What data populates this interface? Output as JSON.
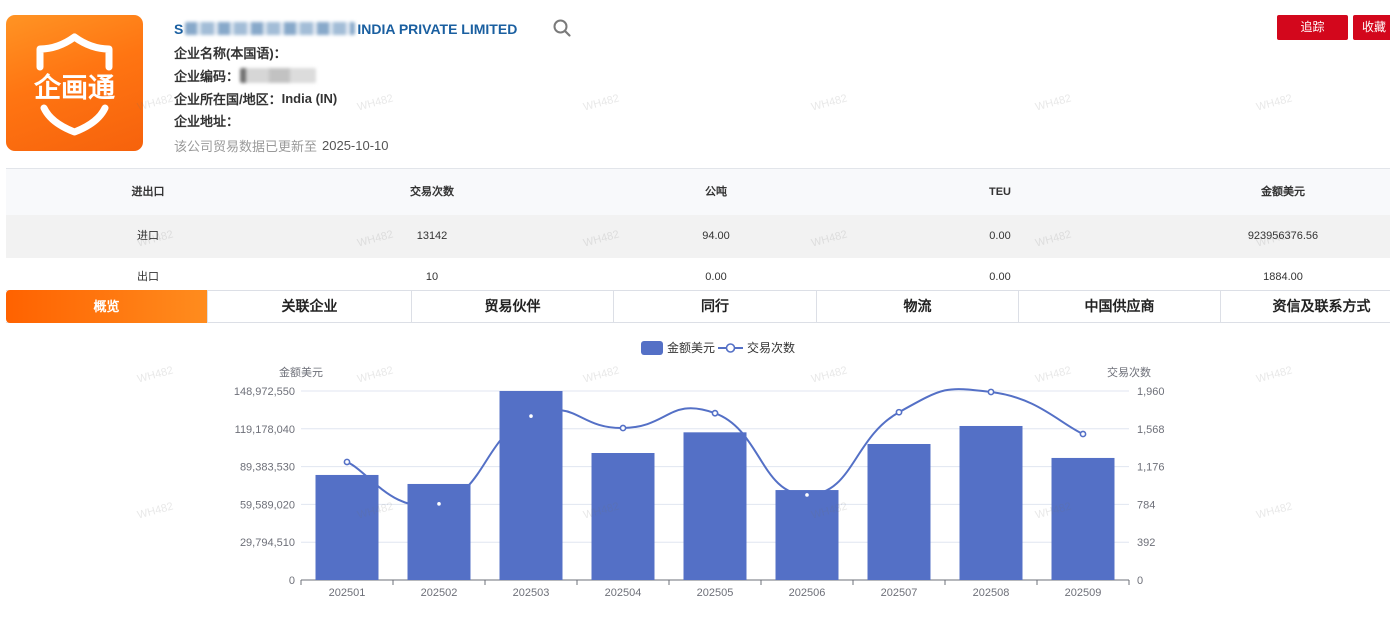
{
  "company": {
    "logo_text": "企画通",
    "name_prefix": "S",
    "name_suffix": "INDIA PRIVATE LIMITED",
    "native_name_label": "企业名称(本国语)：",
    "code_label": "企业编码：",
    "country_label": "企业所在国/地区：",
    "country_value": "India (IN)",
    "address_label": "企业地址：",
    "update_note": "该公司贸易数据已更新至",
    "update_date": "2025-10-10"
  },
  "actions": {
    "track": "追踪",
    "favorite": "收藏"
  },
  "icons": {
    "logo": "shield-icon",
    "search": "search-icon"
  },
  "colors": {
    "brand_orange": "#ff6a00",
    "action_red": "#d3071c",
    "link_blue": "#1a5fa0",
    "series_blue": "#5470c6"
  },
  "watermark": "WH482",
  "summary_table": {
    "headers": [
      "进出口",
      "交易次数",
      "公吨",
      "TEU",
      "金额美元"
    ],
    "rows": [
      [
        "进口",
        "13142",
        "94.00",
        "0.00",
        "923956376.56"
      ],
      [
        "出口",
        "10",
        "0.00",
        "0.00",
        "1884.00"
      ]
    ]
  },
  "tabs": [
    {
      "label": "概览",
      "active": true
    },
    {
      "label": "关联企业",
      "active": false
    },
    {
      "label": "贸易伙伴",
      "active": false
    },
    {
      "label": "同行",
      "active": false
    },
    {
      "label": "物流",
      "active": false
    },
    {
      "label": "中国供应商",
      "active": false
    },
    {
      "label": "资信及联系方式",
      "active": false
    }
  ],
  "chart_data": {
    "type": "bar",
    "categories": [
      "202501",
      "202502",
      "202503",
      "202504",
      "202505",
      "202506",
      "202507",
      "202508",
      "202509"
    ],
    "series": [
      {
        "name": "金额美元",
        "type": "bar",
        "axis": "left",
        "values": [
          82800000,
          75700000,
          148972550,
          100100000,
          116400000,
          70900000,
          107200000,
          121400000,
          96200000
        ]
      },
      {
        "name": "交易次数",
        "type": "line",
        "axis": "right",
        "smooth": true,
        "values": [
          1224,
          790,
          1700,
          1576,
          1730,
          882,
          1740,
          1950,
          1514
        ]
      }
    ],
    "ylabel_left": "金额美元",
    "ylabel_right": "交易次数",
    "ylim_left": [
      0,
      148972550
    ],
    "ylim_right": [
      0,
      1960
    ],
    "y_ticks_left": [
      "0",
      "29,794,510",
      "59,589,020",
      "89,383,530",
      "119,178,040",
      "148,972,550"
    ],
    "y_ticks_right": [
      "0",
      "392",
      "784",
      "1,176",
      "1,568",
      "1,960"
    ],
    "legend_position": "top-center",
    "grid": true
  }
}
